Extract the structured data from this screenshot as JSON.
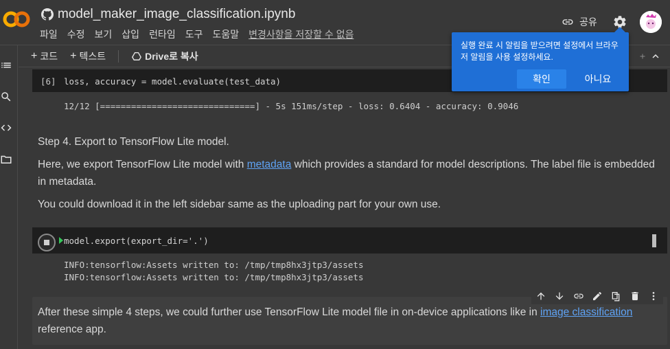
{
  "header": {
    "title": "model_maker_image_classification.ipynb",
    "menu": [
      "파일",
      "수정",
      "보기",
      "삽입",
      "런타임",
      "도구",
      "도움말"
    ],
    "unsaved": "변경사항을 저장할 수 없음",
    "share": "공유",
    "colors": {
      "logo_orange": "#f9ab00",
      "logo_red": "#e8710a"
    }
  },
  "toolbar": {
    "code": "코드",
    "text": "텍스트",
    "drive_copy": "Drive로 복사"
  },
  "cells": {
    "eval_prompt": "[6]",
    "eval_code": "loss, accuracy = model.evaluate(test_data)",
    "eval_output": "12/12 [==============================] - 5s 151ms/step - loss: 0.6404 - accuracy: 0.9046",
    "step4_heading": "Step 4. Export to TensorFlow Lite model.",
    "step4_p1_before": "Here, we export TensorFlow Lite model with ",
    "step4_p1_link": "metadata",
    "step4_p1_after": " which provides a standard for model descriptions. The label file is embedded in metadata.",
    "step4_p2": "You could download it in the left sidebar same as the uploading part for your own use.",
    "export_code": "model.export(export_dir='.')",
    "export_out1": "INFO:tensorflow:Assets written to: /tmp/tmp8hx3jtp3/assets",
    "export_out2": "INFO:tensorflow:Assets written to: /tmp/tmp8hx3jtp3/assets",
    "final_before": "After these simple 4 steps, we could further use TensorFlow Lite model file in on-device applications like in ",
    "final_link": "image classification",
    "final_after": " reference app."
  },
  "popup": {
    "message": "실행 완료 시 알림을 받으려면 설정에서 브라우저 알림을 사용 설정하세요.",
    "ok": "확인",
    "no": "아니요"
  }
}
